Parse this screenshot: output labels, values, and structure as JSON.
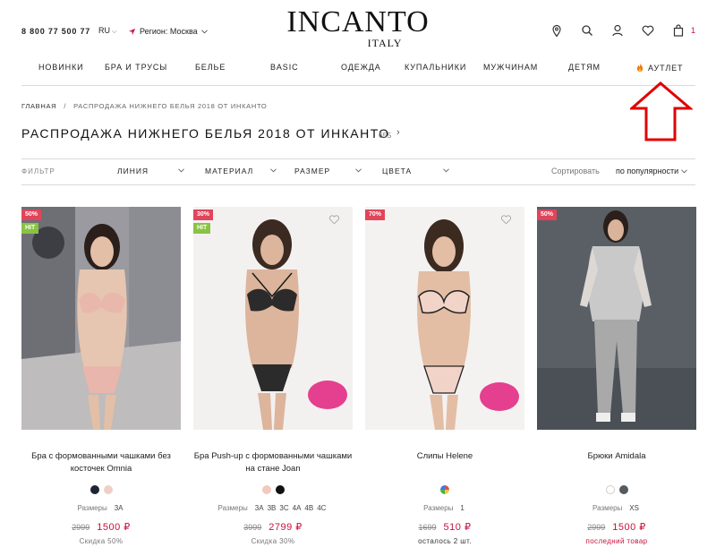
{
  "header": {
    "phone": "8 800 77 500 77",
    "lang": "RU",
    "region": "Регион: Москва",
    "logo": "INCANTO",
    "logo_sub": "ITALY",
    "cart_count": "1"
  },
  "nav": {
    "items": [
      "НОВИНКИ",
      "БРА И ТРУСЫ",
      "БЕЛЬЕ",
      "BASIC",
      "ОДЕЖДА",
      "КУПАЛЬНИКИ",
      "МУЖЧИНАМ",
      "ДЕТЯМ",
      "АУТЛЕТ"
    ]
  },
  "breadcrumb": {
    "home": "ГЛАВНАЯ",
    "sep": "/",
    "current": "РАСПРОДАЖА НИЖНЕГО БЕЛЬЯ 2018 ОТ ИНКАНТО"
  },
  "page": {
    "title": "РАСПРОДАЖА НИЖНЕГО БЕЛЬЯ 2018 ОТ ИНКАНТО",
    "count": "655"
  },
  "filters": {
    "label": "ФИЛЬТР",
    "dropdowns": [
      "ЛИНИЯ",
      "МАТЕРИАЛ",
      "РАЗМЕР",
      "ЦВЕТА"
    ],
    "sort_label": "Сортировать",
    "sort_value": "по популярности"
  },
  "products": [
    {
      "name": "Бра с формованными чашками без косточек Omnia",
      "sale_badge": "50%",
      "hit_badge": "HIT",
      "colors": [
        "#1d2535",
        "#f0cfc8"
      ],
      "sizes_label": "Размеры",
      "sizes": [
        "3A"
      ],
      "old_price": "2999",
      "price": "1500 ₽",
      "note": "Скидка 50%"
    },
    {
      "name": "Бра Push-up с формованными чашками на стане Joan",
      "sale_badge": "30%",
      "hit_badge": "HIT",
      "colors": [
        "#f2c9bd",
        "#111111"
      ],
      "sizes_label": "Размеры",
      "sizes": [
        "3A",
        "3B",
        "3C",
        "4A",
        "4B",
        "4C"
      ],
      "old_price": "3999",
      "price": "2799 ₽",
      "note": "Скидка 30%"
    },
    {
      "name": "Слипы Helene",
      "sale_badge": "70%",
      "colors": [
        "multicolor"
      ],
      "sizes_label": "Размеры",
      "sizes": [
        "1"
      ],
      "old_price": "1699",
      "price": "510 ₽",
      "note": "осталось 2 шт."
    },
    {
      "name": "Брюки Amidala",
      "sale_badge": "50%",
      "colors": [
        "#ffffff",
        "#555a5f"
      ],
      "sizes_label": "Размеры",
      "sizes": [
        "XS"
      ],
      "old_price": "2999",
      "price": "1500 ₽",
      "note": "последний товар"
    }
  ],
  "colors": {
    "accent": "#c8103e",
    "sale_badge": "#e0455a",
    "hit_badge": "#8ac245",
    "annotation_arrow": "#e00000"
  }
}
